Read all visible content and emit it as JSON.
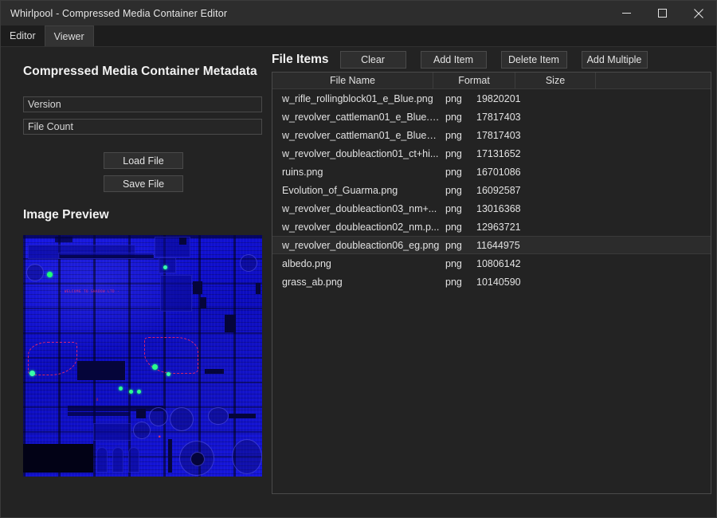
{
  "window": {
    "title": "Whirlpool - Compressed Media Container Editor",
    "controls": [
      {
        "name": "minimize-button",
        "glyph": "minimize"
      },
      {
        "name": "maximize-button",
        "glyph": "maximize"
      },
      {
        "name": "close-button",
        "glyph": "close"
      }
    ]
  },
  "tabs": [
    {
      "label": "Editor",
      "active": true
    },
    {
      "label": "Viewer",
      "active": false
    }
  ],
  "editor": {
    "metadata_heading": "Compressed Media Container Metadata",
    "fields": [
      {
        "name": "version-field",
        "placeholder": "Version",
        "value": ""
      },
      {
        "name": "file-count-field",
        "placeholder": "File Count",
        "value": ""
      }
    ],
    "load_button": "Load File",
    "save_button": "Save File",
    "preview_heading": "Image Preview",
    "preview_overlay_text": "- WELCOME TO SHADOW LTD -"
  },
  "file_items": {
    "title": "File Items",
    "buttons": [
      {
        "name": "clear-button",
        "label": "Clear"
      },
      {
        "name": "add-item-button",
        "label": "Add Item"
      },
      {
        "name": "delete-item-button",
        "label": "Delete Item"
      },
      {
        "name": "add-multiple-button",
        "label": "Add Multiple"
      }
    ],
    "columns": [
      {
        "key": "name",
        "label": "File Name"
      },
      {
        "key": "format",
        "label": "Format"
      },
      {
        "key": "size",
        "label": "Size"
      },
      {
        "key": "pad",
        "label": ""
      }
    ],
    "rows": [
      {
        "name": "w_rifle_rollingblock01_e_Blue.png",
        "format": "png",
        "size": "19820201",
        "hovered": false
      },
      {
        "name": "w_revolver_cattleman01_e_Blue.p...",
        "format": "png",
        "size": "17817403",
        "hovered": false
      },
      {
        "name": "w_revolver_cattleman01_e_Blue_a...",
        "format": "png",
        "size": "17817403",
        "hovered": false
      },
      {
        "name": "w_revolver_doubleaction01_ct+hi...",
        "format": "png",
        "size": "17131652",
        "hovered": false
      },
      {
        "name": "ruins.png",
        "format": "png",
        "size": "16701086",
        "hovered": false
      },
      {
        "name": "Evolution_of_Guarma.png",
        "format": "png",
        "size": "16092587",
        "hovered": false
      },
      {
        "name": "w_revolver_doubleaction03_nm+...",
        "format": "png",
        "size": "13016368",
        "hovered": false
      },
      {
        "name": "w_revolver_doubleaction02_nm.p...",
        "format": "png",
        "size": "12963721",
        "hovered": false
      },
      {
        "name": "w_revolver_doubleaction06_eg.png",
        "format": "png",
        "size": "11644975",
        "hovered": true
      },
      {
        "name": "albedo.png",
        "format": "png",
        "size": "10806142",
        "hovered": false
      },
      {
        "name": "grass_ab.png",
        "format": "png",
        "size": "10140590",
        "hovered": false
      }
    ]
  },
  "colors": {
    "window_bg": "#232323",
    "titlebar_bg": "#2d2d2d",
    "tab_active_bg": "#1d1d1d",
    "tab_inactive_bg": "#333333",
    "button_bg": "#2f2f2f",
    "border": "#4a4a4a",
    "text": "#e4e4e4",
    "row_hover_bg": "#2c2c2c",
    "preview_primary": "#0f0fd2",
    "preview_marker": "#1eff78",
    "preview_accent": "#d6246e"
  }
}
